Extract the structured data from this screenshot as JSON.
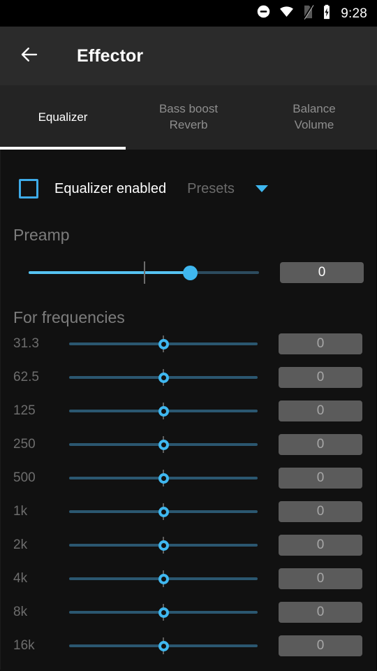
{
  "status_bar": {
    "icons": [
      {
        "name": "do-not-disturb-icon",
        "glyph": "dnd"
      },
      {
        "name": "wifi-icon",
        "glyph": "wifi"
      },
      {
        "name": "no-sim-icon",
        "glyph": "no-sim"
      },
      {
        "name": "battery-charging-icon",
        "glyph": "battery-charging"
      }
    ],
    "time": "9:28"
  },
  "app_bar": {
    "back_icon": "back-arrow-icon",
    "title": "Effector"
  },
  "tabs": [
    {
      "name": "tab-equalizer",
      "lines": [
        "Equalizer"
      ],
      "active": true
    },
    {
      "name": "tab-bass-boost-reverb",
      "lines": [
        "Bass boost",
        "Reverb"
      ],
      "active": false
    },
    {
      "name": "tab-balance-volume",
      "lines": [
        "Balance",
        "Volume"
      ],
      "active": false
    }
  ],
  "equalizer": {
    "enabled_label": "Equalizer enabled",
    "enabled_checked": false,
    "presets_label": "Presets",
    "dropdown_icon": "chevron-down-icon",
    "preamp": {
      "title": "Preamp",
      "value": "0",
      "slider_percent": 70
    },
    "frequencies_title": "For frequencies",
    "bands": [
      {
        "label": "31.3",
        "value": "0",
        "slider_percent": 50
      },
      {
        "label": "62.5",
        "value": "0",
        "slider_percent": 50
      },
      {
        "label": "125",
        "value": "0",
        "slider_percent": 50
      },
      {
        "label": "250",
        "value": "0",
        "slider_percent": 50
      },
      {
        "label": "500",
        "value": "0",
        "slider_percent": 50
      },
      {
        "label": "1k",
        "value": "0",
        "slider_percent": 50
      },
      {
        "label": "2k",
        "value": "0",
        "slider_percent": 50
      },
      {
        "label": "4k",
        "value": "0",
        "slider_percent": 50
      },
      {
        "label": "8k",
        "value": "0",
        "slider_percent": 50
      },
      {
        "label": "16k",
        "value": "0",
        "slider_percent": 50
      }
    ]
  },
  "colors": {
    "accent": "#3fb7ef",
    "accent_bright": "#56c3f2",
    "app_bar_bg": "#2b2b2b",
    "tab_bar_bg": "#242424",
    "content_bg": "#111111",
    "value_box_bg": "#5b5b5b"
  }
}
